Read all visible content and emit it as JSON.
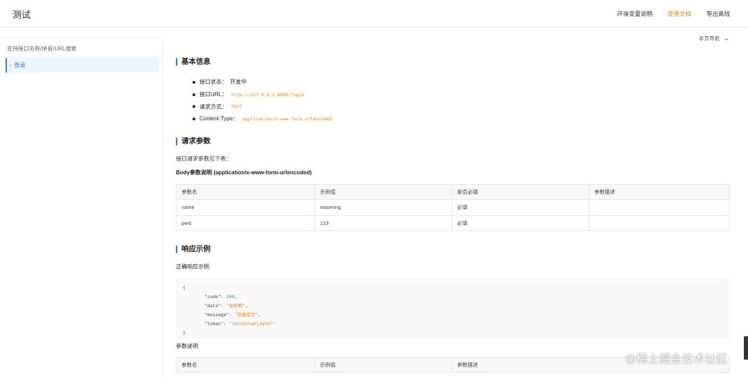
{
  "header": {
    "title": "测试",
    "links": [
      "环境变量说明",
      "使用文档",
      "导出离线"
    ]
  },
  "sidebar": {
    "search_placeholder": "支持接口名称/拼音/URL搜索",
    "item_prefix": "›",
    "items": [
      {
        "label": "登录"
      }
    ]
  },
  "page_nav": {
    "label": "本页导航"
  },
  "sections": {
    "basic": "基本信息",
    "request": "请求参数",
    "response": "响应示例"
  },
  "basic_info": {
    "status_label": "接口状态：",
    "status_value": "开发中",
    "url_label": "接口URL：",
    "url_value": "http://127.0.0.1:8888/login",
    "method_label": "请求方式：",
    "method_value": "POST",
    "content_type_label": "Content-Type：",
    "content_type_value": "application/x-www-form-urlencoded"
  },
  "request": {
    "intro": "接口请求参数见下表：",
    "body_title": "Body参数说明 (application/x-www-form-urlencoded)",
    "headers": [
      "参数名",
      "示例值",
      "是否必填",
      "参数描述"
    ],
    "rows": [
      [
        "name",
        "xiaoming",
        "必填",
        ""
      ],
      [
        "pwd",
        "123",
        "必填",
        ""
      ]
    ]
  },
  "response": {
    "success_title": "正确响应示例",
    "code": {
      "open": "{",
      "close": "}",
      "code_key": "\"code\"",
      "code_val": "200",
      "data_key": "\"data\"",
      "data_val": "\"你好啊\"",
      "message_key": "\"message\"",
      "message_val": "\"登录成功\"",
      "token_key": "\"token\"",
      "token_val": "\"1651A55a612q547\""
    },
    "params_title": "参数说明",
    "params_headers": [
      "参数名",
      "示例值",
      "参数描述"
    ]
  },
  "watermark": "@稀土掘金技术社区"
}
